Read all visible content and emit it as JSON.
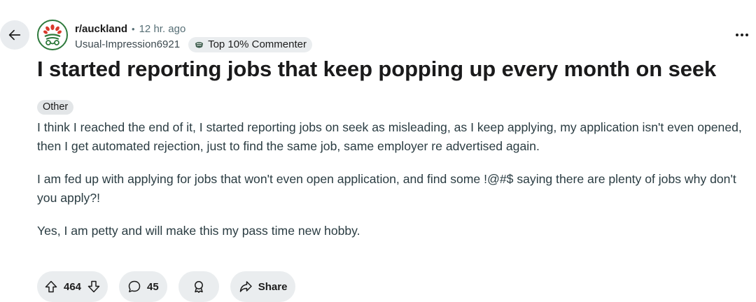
{
  "post": {
    "subreddit": "r/auckland",
    "separator": "•",
    "time_ago": "12 hr. ago",
    "author": "Usual-Impression6921",
    "author_flair": "Top 10% Commenter",
    "title": "I started reporting jobs that keep popping up every month on seek",
    "post_flair": "Other",
    "body": [
      "I think I reached the end of it, I started reporting jobs on seek as misleading, as I keep applying, my application isn't even opened, then I get automated rejection, just to find the same job, same employer re advertised again.",
      "I am fed up with applying for jobs that won't even open application, and find some !@#$ saying there are plenty of jobs why don't you apply?!",
      "Yes, I am petty and will make this my pass time new hobby."
    ]
  },
  "actions": {
    "votes": "464",
    "comments": "45",
    "share_label": "Share"
  },
  "icons": {
    "back": "arrow-left-icon",
    "avatar": "subreddit-avatar",
    "flair": "commenter-badge-icon",
    "more": "ellipsis-icon",
    "upvote": "upvote-arrow-icon",
    "downvote": "downvote-arrow-icon",
    "comment": "comment-bubble-icon",
    "award": "award-icon",
    "share": "share-arrow-icon"
  },
  "colors": {
    "pill_background": "#eaedef",
    "avatar_green": "#2e7a3c",
    "avatar_red": "#d93a2b",
    "meta_gray": "#576f76"
  }
}
